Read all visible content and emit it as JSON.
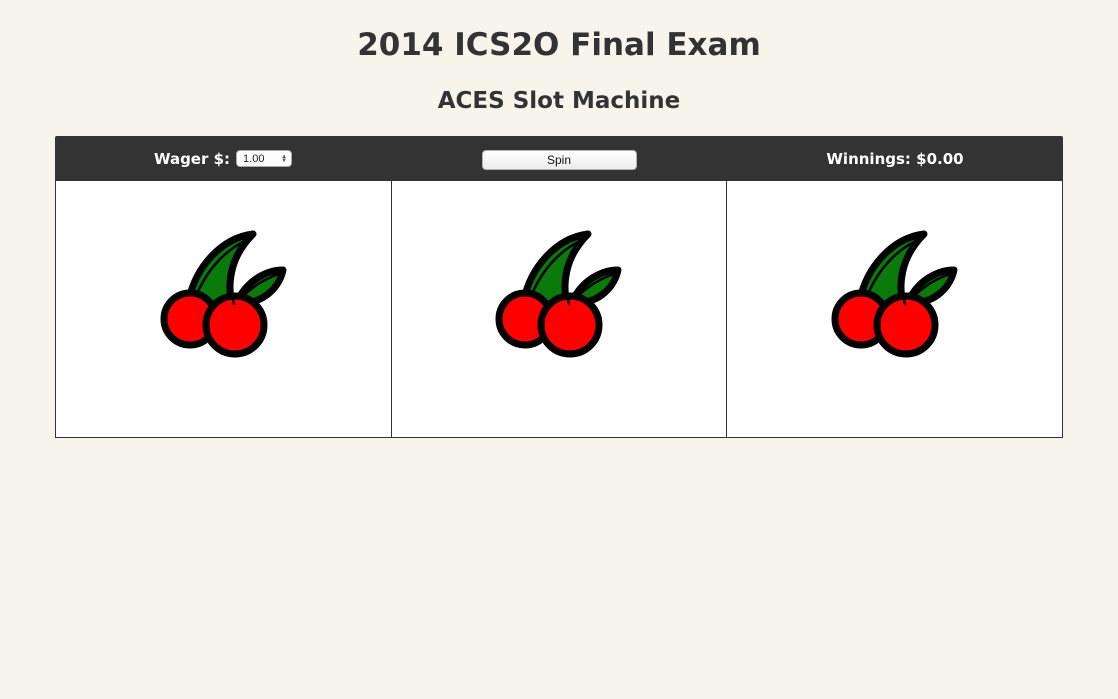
{
  "page": {
    "title": "2014 ICS2O Final Exam",
    "subtitle": "ACES Slot Machine"
  },
  "controls": {
    "wager_label": "Wager $:",
    "wager_value": "1.00",
    "spin_label": "Spin",
    "winnings_label": "Winnings: $0.00"
  },
  "reels": [
    {
      "symbol": "cherries-icon"
    },
    {
      "symbol": "cherries-icon"
    },
    {
      "symbol": "cherries-icon"
    }
  ],
  "colors": {
    "background": "#f7f4ec",
    "bar": "#333333",
    "cherry": "#ff0000",
    "leaf": "#0a7a0a"
  }
}
